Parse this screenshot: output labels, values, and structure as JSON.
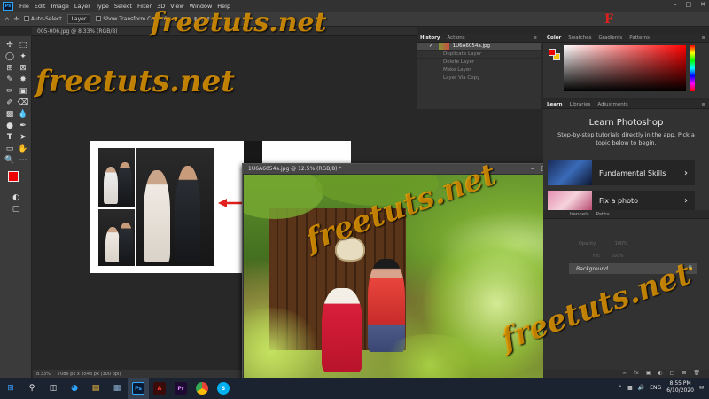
{
  "menubar": {
    "logo": "Ps",
    "items": [
      "File",
      "Edit",
      "Image",
      "Layer",
      "Type",
      "Select",
      "Filter",
      "3D",
      "View",
      "Window",
      "Help"
    ]
  },
  "options": {
    "auto_select": "Auto-Select",
    "layer": "Layer",
    "show_transform": "Show Transform Controls"
  },
  "doc1": {
    "tab": "005-006.jpg @ 8.33% (RGB/8)",
    "zoom": "8.33%",
    "size": "7086 px x 3543 px (300 ppi)"
  },
  "doc2": {
    "title": "1U6A6054a.jpg @ 12.5% (RGB/8) *"
  },
  "history": {
    "tabs": [
      "History",
      "Actions"
    ],
    "snapshot": "1U6A6054a.jpg",
    "rows": [
      "Duplicate Layer",
      "Delete Layer",
      "Make Layer",
      "Layer Via Copy"
    ]
  },
  "color": {
    "tabs": [
      "Color",
      "Swatches",
      "Gradients",
      "Patterns"
    ],
    "fg": "#e00000",
    "bg": "#f5c400"
  },
  "learn": {
    "tabs": [
      "Learn",
      "Libraries",
      "Adjustments"
    ],
    "title": "Learn Photoshop",
    "subtitle": "Step-by-step tutorials directly in the app. Pick a topic below to begin.",
    "cards": [
      "Fundamental Skills",
      "Fix a photo"
    ]
  },
  "layers": {
    "tabs": [
      "hannels",
      "Paths"
    ],
    "opacity": "Opacity:",
    "fill": "Fill:",
    "percent": "100%",
    "background": "Background"
  },
  "taskbar": {
    "lang": "ENG",
    "time": "8:55 PM",
    "date": "6/10/2020"
  },
  "watermark": {
    "text": "freetuts.net"
  }
}
